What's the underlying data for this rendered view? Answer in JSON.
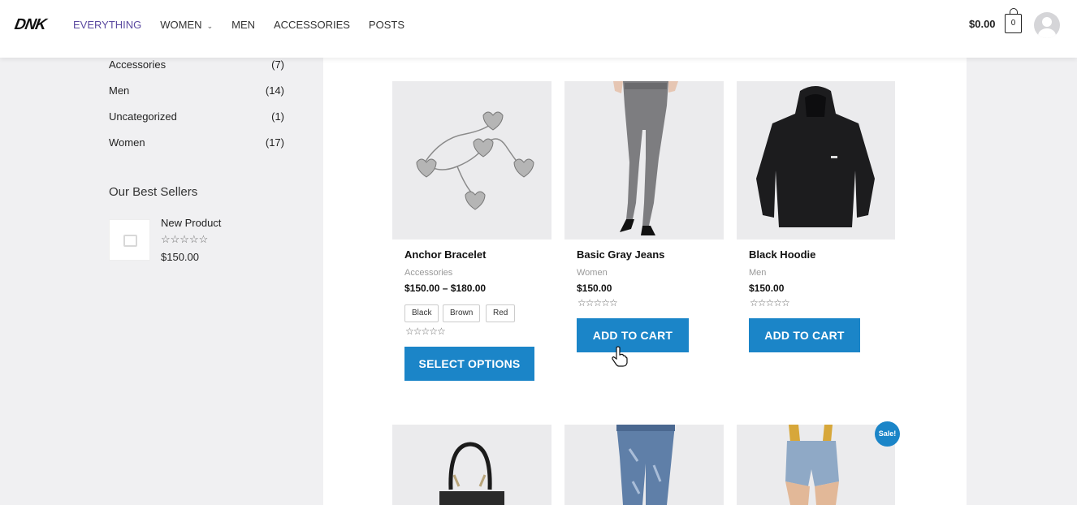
{
  "header": {
    "logo": "DNK",
    "nav": [
      {
        "label": "EVERYTHING",
        "active": true
      },
      {
        "label": "WOMEN",
        "has_dropdown": true
      },
      {
        "label": "MEN"
      },
      {
        "label": "ACCESSORIES"
      },
      {
        "label": "POSTS"
      }
    ],
    "cart_total": "$0.00",
    "cart_count": "0"
  },
  "sidebar": {
    "categories": [
      {
        "name": "Accessories",
        "count": "(7)"
      },
      {
        "name": "Men",
        "count": "(14)"
      },
      {
        "name": "Uncategorized",
        "count": "(1)"
      },
      {
        "name": "Women",
        "count": "(17)"
      }
    ],
    "best_sellers_title": "Our Best Sellers",
    "best_sellers": [
      {
        "name": "New Product",
        "stars": "☆☆☆☆☆",
        "price": "$150.00"
      }
    ]
  },
  "products": [
    {
      "name": "Anchor Bracelet",
      "category": "Accessories",
      "price": "$150.00 – $180.00",
      "swatches": [
        "Black",
        "Brown",
        "Red"
      ],
      "stars": "☆☆☆☆☆",
      "button": "SELECT OPTIONS"
    },
    {
      "name": "Basic Gray Jeans",
      "category": "Women",
      "price": "$150.00",
      "stars": "☆☆☆☆☆",
      "button": "ADD TO CART"
    },
    {
      "name": "Black Hoodie",
      "category": "Men",
      "price": "$150.00",
      "stars": "☆☆☆☆☆",
      "button": "ADD TO CART"
    }
  ],
  "second_row": {
    "sale_badge": "Sale!"
  },
  "colors": {
    "accent": "#1b85c8",
    "nav_active": "#5b4aa0",
    "page_bg": "#f0f0f2"
  }
}
